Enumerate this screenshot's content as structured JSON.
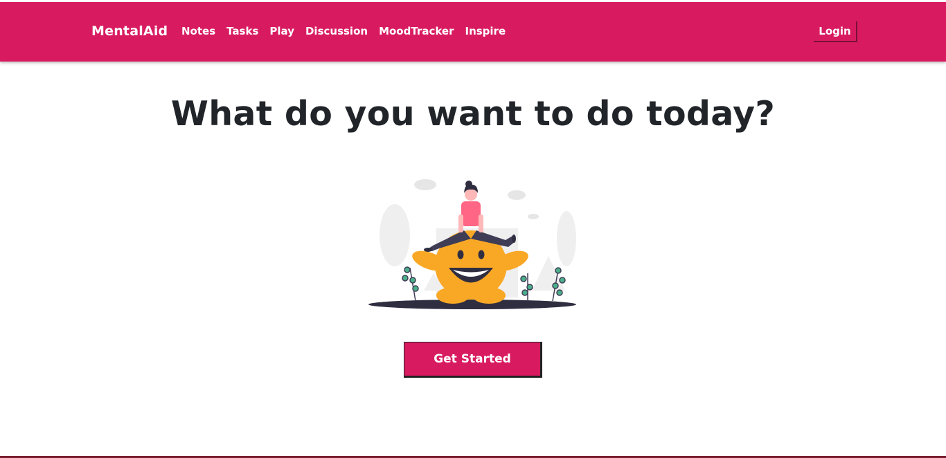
{
  "brand": {
    "name": "MentalAid"
  },
  "nav": {
    "links": [
      "Notes",
      "Tasks",
      "Play",
      "Discussion",
      "MoodTracker",
      "Inspire"
    ],
    "login_label": "Login"
  },
  "hero": {
    "title": "What do you want to do today?",
    "cta_label": "Get Started",
    "illustration_icon": "person-on-smiling-monster-illustration"
  },
  "colors": {
    "brand": "#d81b60",
    "text_dark": "#212529",
    "monster": "#f9a826",
    "shirt": "#ff6584",
    "plant": "#4bb08a"
  }
}
